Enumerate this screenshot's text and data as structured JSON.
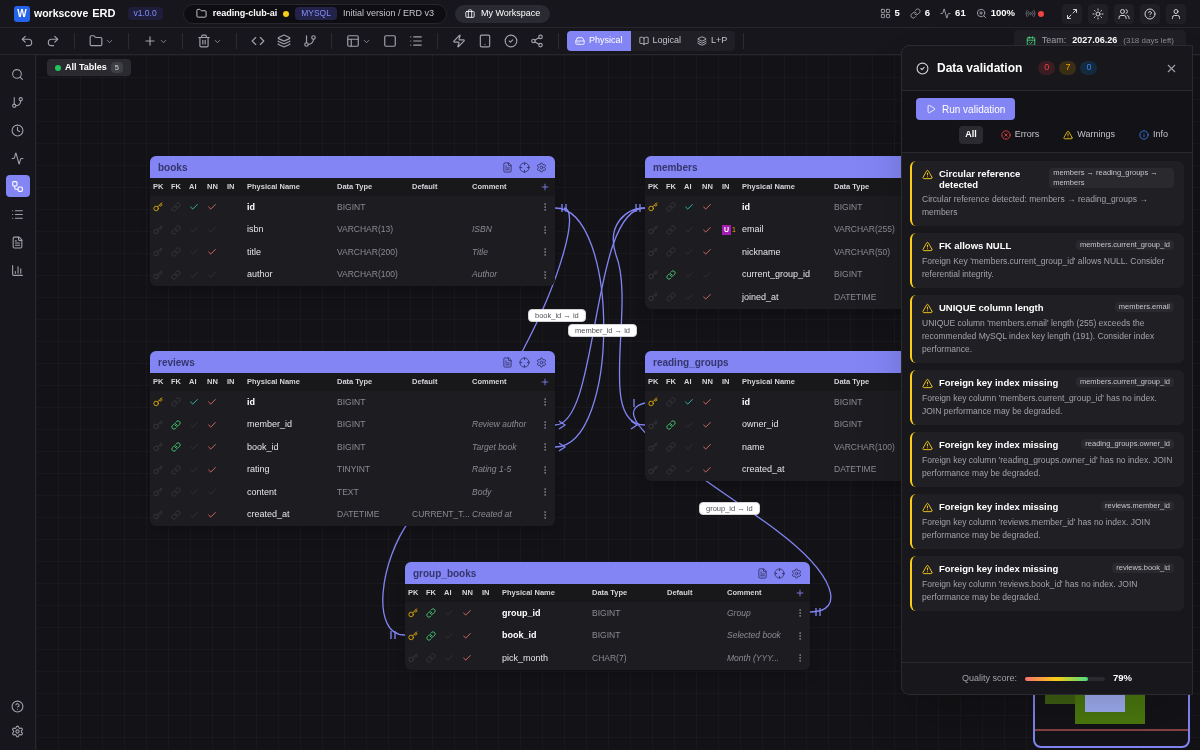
{
  "app": {
    "logo_letter": "W",
    "brand": "workscove",
    "product": "ERD",
    "version": "v1.0.0"
  },
  "project": {
    "name": "reading-club-ai",
    "unsaved": true,
    "db": "MYSQL",
    "version_label": "Initial version / ERD v3"
  },
  "workspace": {
    "label": "My Workspace"
  },
  "stats": [
    {
      "kind": "tables",
      "value": "5"
    },
    {
      "kind": "relations",
      "value": "6"
    },
    {
      "kind": "activity",
      "value": "61"
    },
    {
      "kind": "zoom",
      "value": "100%"
    }
  ],
  "live": {
    "connected": false
  },
  "views": [
    {
      "kind": "physical",
      "label": "Physical",
      "selected": true
    },
    {
      "kind": "logical",
      "label": "Logical",
      "selected": false
    },
    {
      "kind": "both",
      "label": "L+P",
      "selected": false
    }
  ],
  "team": {
    "label": "Team:",
    "date": "2027.06.26",
    "remaining": "(318 days left)"
  },
  "sidebar": [
    {
      "kind": "search",
      "selected": false
    },
    {
      "kind": "branch",
      "selected": false
    },
    {
      "kind": "history",
      "selected": false
    },
    {
      "kind": "activity",
      "selected": false
    },
    {
      "kind": "diagram",
      "selected": true
    },
    {
      "kind": "list",
      "selected": false
    },
    {
      "kind": "document",
      "selected": false
    },
    {
      "kind": "chart",
      "selected": false
    }
  ],
  "filter_chip": {
    "label": "All Tables",
    "count": "5"
  },
  "tables": [
    {
      "name": "books",
      "headers": [
        "PK",
        "FK",
        "AI",
        "NN",
        "IN",
        "Physical Name",
        "Data Type",
        "Default",
        "Comment"
      ],
      "rows": [
        {
          "pk": true,
          "fk": false,
          "ai": true,
          "nn": true,
          "name": "id",
          "type": "BIGINT"
        },
        {
          "pk": false,
          "fk": false,
          "ai": false,
          "nn": false,
          "name": "isbn",
          "type": "VARCHAR(13)",
          "comment": "ISBN"
        },
        {
          "pk": false,
          "fk": false,
          "ai": false,
          "nn": true,
          "name": "title",
          "type": "VARCHAR(200)",
          "comment": "Title"
        },
        {
          "pk": false,
          "fk": false,
          "ai": false,
          "nn": false,
          "name": "author",
          "type": "VARCHAR(100)",
          "comment": "Author"
        }
      ]
    },
    {
      "name": "reviews",
      "headers": [
        "PK",
        "FK",
        "AI",
        "NN",
        "IN",
        "Physical Name",
        "Data Type",
        "Default",
        "Comment"
      ],
      "rows": [
        {
          "pk": true,
          "fk": false,
          "ai": true,
          "nn": true,
          "name": "id",
          "type": "BIGINT"
        },
        {
          "pk": false,
          "fk": true,
          "ai": false,
          "nn": true,
          "name": "member_id",
          "type": "BIGINT",
          "comment": "Review author"
        },
        {
          "pk": false,
          "fk": true,
          "ai": false,
          "nn": true,
          "name": "book_id",
          "type": "BIGINT",
          "comment": "Target book"
        },
        {
          "pk": false,
          "fk": false,
          "ai": false,
          "nn": true,
          "name": "rating",
          "type": "TINYINT",
          "comment": "Rating 1-5"
        },
        {
          "pk": false,
          "fk": false,
          "ai": false,
          "nn": false,
          "name": "content",
          "type": "TEXT",
          "comment": "Body"
        },
        {
          "pk": false,
          "fk": false,
          "ai": false,
          "nn": true,
          "name": "created_at",
          "type": "DATETIME",
          "default": "CURRENT_T...",
          "comment": "Created at"
        }
      ]
    },
    {
      "name": "members",
      "headers": [
        "PK",
        "FK",
        "AI",
        "NN",
        "IN",
        "Physical Name",
        "Data Type"
      ],
      "rows": [
        {
          "pk": true,
          "fk": false,
          "ai": true,
          "nn": true,
          "name": "id",
          "type": "BIGINT"
        },
        {
          "pk": false,
          "fk": false,
          "ai": false,
          "nn": true,
          "name": "email",
          "type": "VARCHAR(255)",
          "unique": {
            "label": "U",
            "index": "1"
          }
        },
        {
          "pk": false,
          "fk": false,
          "ai": false,
          "nn": true,
          "name": "nickname",
          "type": "VARCHAR(50)"
        },
        {
          "pk": false,
          "fk": true,
          "ai": false,
          "nn": false,
          "name": "current_group_id",
          "type": "BIGINT"
        },
        {
          "pk": false,
          "fk": false,
          "ai": false,
          "nn": true,
          "name": "joined_at",
          "type": "DATETIME"
        }
      ]
    },
    {
      "name": "reading_groups",
      "headers": [
        "PK",
        "FK",
        "AI",
        "NN",
        "IN",
        "Physical Name",
        "Data Type"
      ],
      "rows": [
        {
          "pk": true,
          "fk": false,
          "ai": true,
          "nn": true,
          "name": "id",
          "type": "BIGINT"
        },
        {
          "pk": false,
          "fk": true,
          "ai": false,
          "nn": true,
          "name": "owner_id",
          "type": "BIGINT"
        },
        {
          "pk": false,
          "fk": false,
          "ai": false,
          "nn": true,
          "name": "name",
          "type": "VARCHAR(100)"
        },
        {
          "pk": false,
          "fk": false,
          "ai": false,
          "nn": true,
          "name": "created_at",
          "type": "DATETIME"
        }
      ]
    },
    {
      "name": "group_books",
      "headers": [
        "PK",
        "FK",
        "AI",
        "NN",
        "IN",
        "Physical Name",
        "Data Type",
        "Default",
        "Comment"
      ],
      "rows": [
        {
          "pk": true,
          "fk": true,
          "ai": false,
          "nn": true,
          "name": "group_id",
          "type": "BIGINT",
          "comment": "Group"
        },
        {
          "pk": true,
          "fk": true,
          "ai": false,
          "nn": true,
          "name": "book_id",
          "type": "BIGINT",
          "comment": "Selected book"
        },
        {
          "pk": false,
          "fk": false,
          "ai": false,
          "nn": true,
          "name": "pick_month",
          "type": "CHAR(7)",
          "comment": "Month (YYY..."
        }
      ]
    }
  ],
  "relations": [
    {
      "label": "book_id → id"
    },
    {
      "label": "member_id → id"
    },
    {
      "label": "group_id → id"
    }
  ],
  "validation": {
    "title": "Data validation",
    "counts": [
      {
        "kind": "error",
        "value": "0"
      },
      {
        "kind": "warning",
        "value": "7"
      },
      {
        "kind": "info",
        "value": "0"
      }
    ],
    "run_label": "Run validation",
    "filters": [
      {
        "kind": "all",
        "label": "All",
        "selected": true
      },
      {
        "kind": "error",
        "label": "Errors",
        "selected": false
      },
      {
        "kind": "warning",
        "label": "Warnings",
        "selected": false
      },
      {
        "kind": "info",
        "label": "Info",
        "selected": false
      }
    ],
    "issues": [
      {
        "kind": "warning",
        "title": "Circular reference detected",
        "target": "members → reading_groups → members",
        "message": "Circular reference detected: members → reading_groups → members"
      },
      {
        "kind": "warning",
        "title": "FK allows NULL",
        "target": "members.current_group_id",
        "message": "Foreign Key 'members.current_group_id' allows NULL. Consider referential integrity."
      },
      {
        "kind": "warning",
        "title": "UNIQUE column length",
        "target": "members.email",
        "message": "UNIQUE column 'members.email' length (255) exceeds the recommended MySQL index key length (191). Consider index performance."
      },
      {
        "kind": "warning",
        "title": "Foreign key index missing",
        "target": "members.current_group_id",
        "message": "Foreign key column 'members.current_group_id' has no index. JOIN performance may be degraded."
      },
      {
        "kind": "warning",
        "title": "Foreign key index missing",
        "target": "reading_groups.owner_id",
        "message": "Foreign key column 'reading_groups.owner_id' has no index. JOIN performance may be degraded."
      },
      {
        "kind": "warning",
        "title": "Foreign key index missing",
        "target": "reviews.member_id",
        "message": "Foreign key column 'reviews.member_id' has no index. JOIN performance may be degraded."
      },
      {
        "kind": "warning",
        "title": "Foreign key index missing",
        "target": "reviews.book_id",
        "message": "Foreign key column 'reviews.book_id' has no index. JOIN performance may be degraded."
      }
    ],
    "quality": {
      "label": "Quality score:",
      "level": 0.79,
      "value": "79%"
    }
  }
}
